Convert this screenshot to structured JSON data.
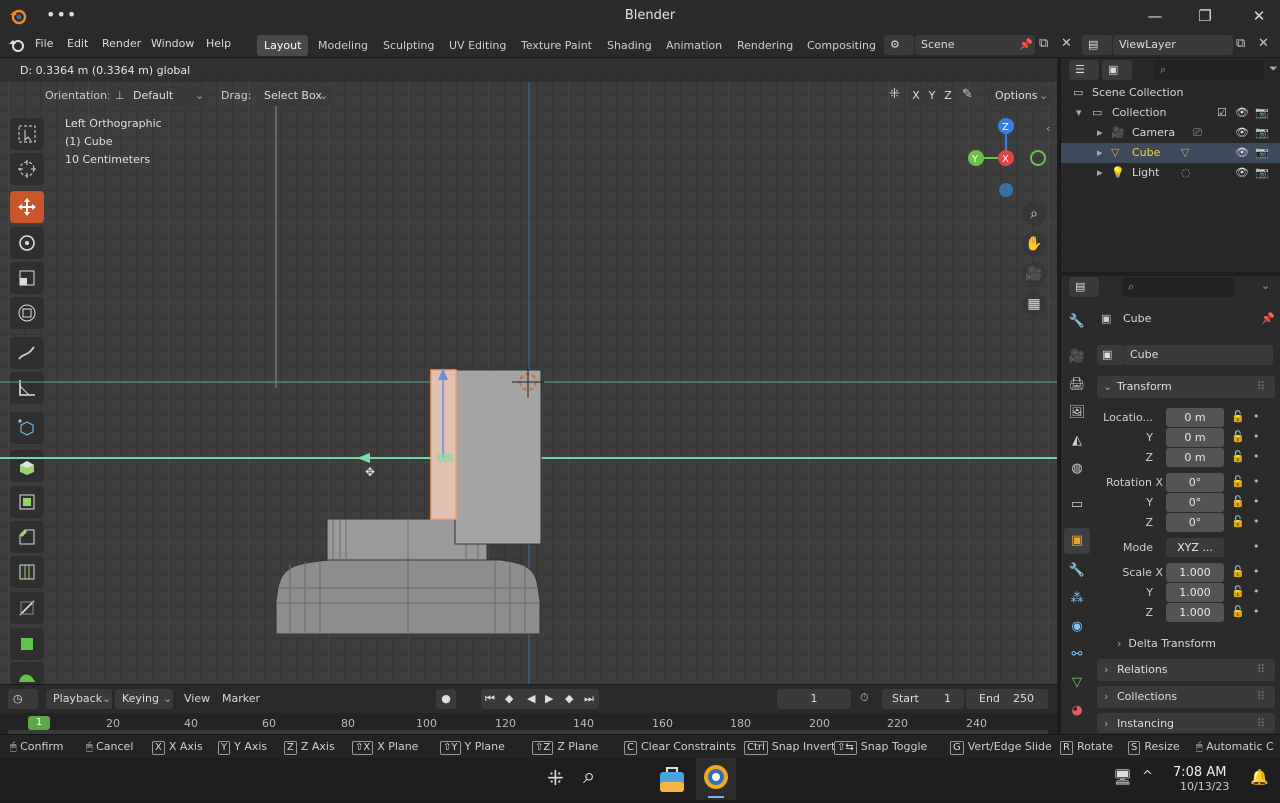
{
  "window": {
    "title": "Blender"
  },
  "menu": {
    "items": [
      "File",
      "Edit",
      "Render",
      "Window",
      "Help"
    ]
  },
  "workspaces": {
    "tabs": [
      "Layout",
      "Modeling",
      "Sculpting",
      "UV Editing",
      "Texture Paint",
      "Shading",
      "Animation",
      "Rendering",
      "Compositing"
    ],
    "active": "Layout"
  },
  "scene": {
    "name": "Scene"
  },
  "viewlayer": {
    "name": "ViewLayer"
  },
  "header": {
    "status_text": "D: 0.3364 m (0.3364 m) global",
    "orientation_label": "Orientation:",
    "orientation_value": "Default",
    "drag_label": "Drag:",
    "drag_value": "Select Box",
    "axes": [
      "X",
      "Y",
      "Z"
    ],
    "options_label": "Options"
  },
  "viewport": {
    "view_name": "Left Orthographic",
    "object_info": "(1) Cube",
    "scale_info": "10 Centimeters",
    "gizmo": {
      "z": "Z",
      "y": "Y",
      "x": "X"
    }
  },
  "outliner": {
    "root": "Scene Collection",
    "collection": "Collection",
    "items": [
      {
        "name": "Camera",
        "selected": false
      },
      {
        "name": "Cube",
        "selected": true
      },
      {
        "name": "Light",
        "selected": false
      }
    ]
  },
  "properties": {
    "object_name": "Cube",
    "mesh_name": "Cube",
    "transform_header": "Transform",
    "location_label": "Locatio...",
    "location": [
      "0 m",
      "0 m",
      "0 m"
    ],
    "rotation_label": "Rotation X",
    "rotation": [
      "0°",
      "0°",
      "0°"
    ],
    "mode_label": "Mode",
    "mode_value": "XYZ ...",
    "scale_label": "Scale X",
    "scale": [
      "1.000",
      "1.000",
      "1.000"
    ],
    "axis_y": "Y",
    "axis_z": "Z",
    "delta_header": "Delta Transform",
    "sections": [
      "Relations",
      "Collections",
      "Instancing"
    ]
  },
  "timeline": {
    "playback": "Playback",
    "keying": "Keying",
    "view": "View",
    "marker": "Marker",
    "current_frame": "1",
    "start_label": "Start",
    "start_value": "1",
    "end_label": "End",
    "end_value": "250",
    "ticks": [
      "20",
      "40",
      "60",
      "80",
      "100",
      "120",
      "140",
      "160",
      "180",
      "200",
      "220",
      "240"
    ],
    "playhead": "1"
  },
  "statusbar": {
    "items": [
      {
        "key": "",
        "label": "Confirm"
      },
      {
        "key": "",
        "label": "Cancel"
      },
      {
        "key": "X",
        "label": "X Axis"
      },
      {
        "key": "Y",
        "label": "Y Axis"
      },
      {
        "key": "Z",
        "label": "Z Axis"
      },
      {
        "key": "⇧X",
        "label": "X Plane"
      },
      {
        "key": "⇧Y",
        "label": "Y Plane"
      },
      {
        "key": "⇧Z",
        "label": "Z Plane"
      },
      {
        "key": "C",
        "label": "Clear Constraints"
      },
      {
        "key": "Ctrl",
        "label": "Snap Invert"
      },
      {
        "key": "⇧⇆",
        "label": "Snap Toggle"
      },
      {
        "key": "G",
        "label": "Vert/Edge Slide"
      },
      {
        "key": "R",
        "label": "Rotate"
      },
      {
        "key": "S",
        "label": "Resize"
      },
      {
        "key": "",
        "label": "Automatic C"
      }
    ]
  },
  "taskbar": {
    "time": "7:08 AM",
    "date": "10/13/23"
  },
  "colors": {
    "accent": "#c9562b",
    "selected_text": "#ffd23c",
    "x_axis": "#e04646",
    "y_axis": "#6fbf4a",
    "z_axis": "#3c7de0"
  }
}
